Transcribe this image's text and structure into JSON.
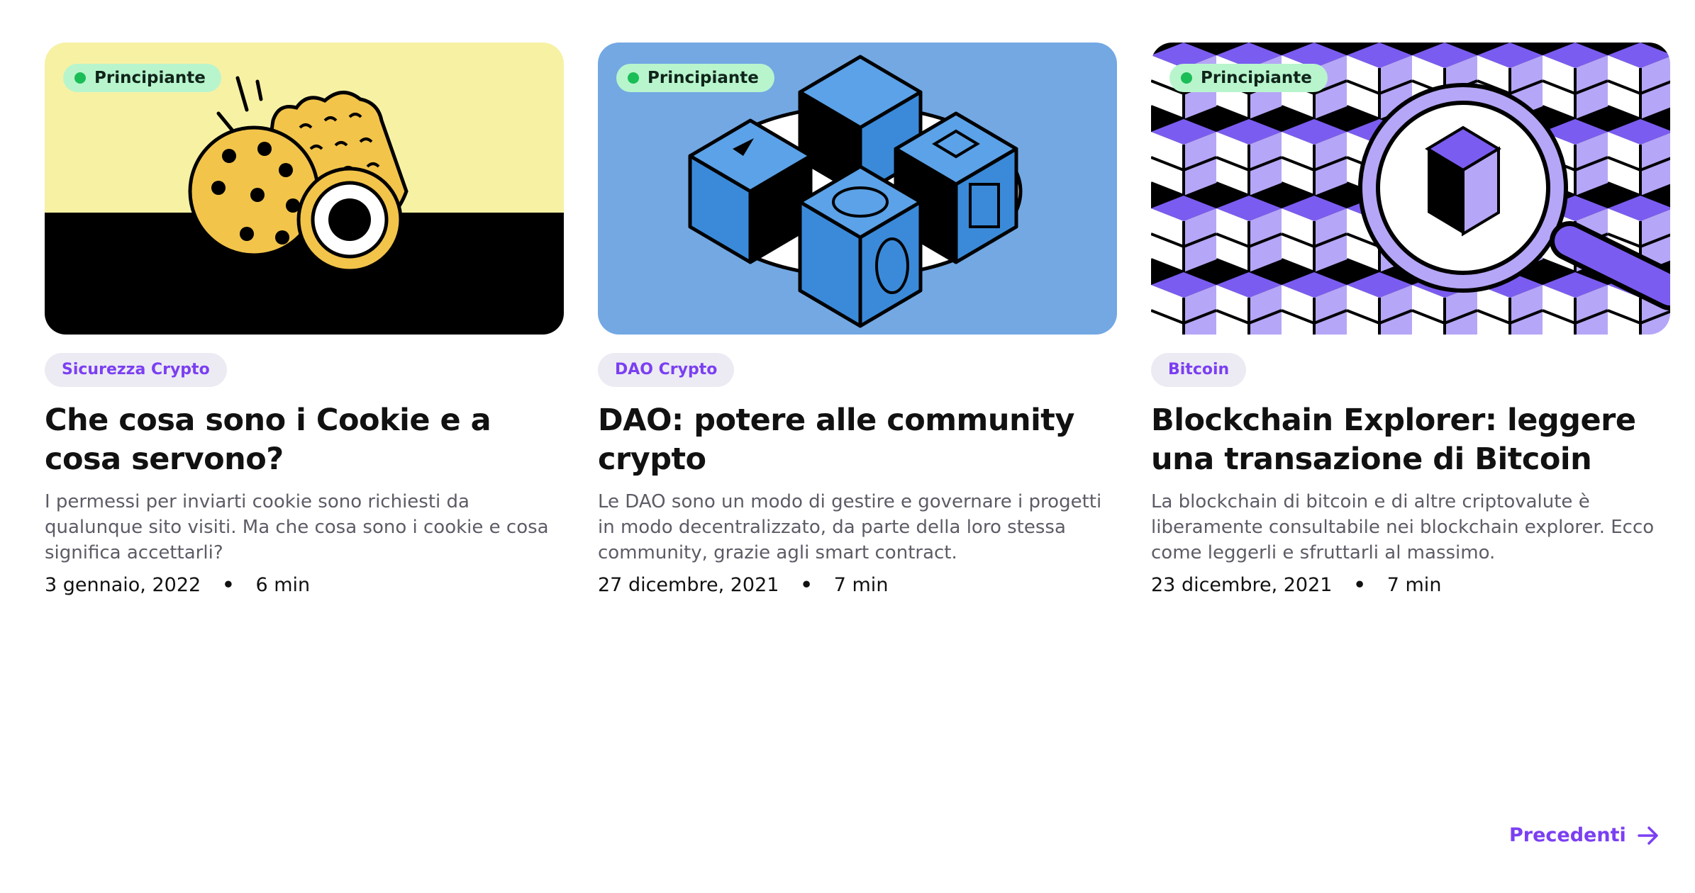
{
  "articles": [
    {
      "level": "Principiante",
      "category": "Sicurezza Crypto",
      "title": "Che cosa sono i Cookie e a cosa servono?",
      "description": "I permessi per inviarti cookie sono richiesti da qualunque sito visiti. Ma che cosa sono i cookie e cosa significa accettarli?",
      "date": "3 gennaio, 2022",
      "read_time": "6 min",
      "thumb_colors": {
        "top": "#f7f1a4",
        "bottom": "#000000"
      }
    },
    {
      "level": "Principiante",
      "category": "DAO Crypto",
      "title": "DAO: potere alle community crypto",
      "description": "Le DAO sono un modo di gestire e governare i progetti in modo decentralizzato, da parte della loro stessa community, grazie agli smart contract.",
      "date": "27 dicembre, 2021",
      "read_time": "7 min",
      "thumb_colors": {
        "background": "#73a8e3",
        "cube": "#3a8ad9"
      }
    },
    {
      "level": "Principiante",
      "category": "Bitcoin",
      "title": "Blockchain Explorer: leggere una transazione di Bitcoin",
      "description": "La blockchain di bitcoin e di altre criptovalute è liberamente consultabile nei blockchain explorer. Ecco come leggerli e sfruttarli al massimo.",
      "date": "23 dicembre, 2021",
      "read_time": "7 min",
      "thumb_colors": {
        "purple": "#7b5cf0",
        "lavender": "#b6a6f7"
      }
    }
  ],
  "pagination": {
    "label": "Precedenti"
  },
  "separator": "•",
  "colors": {
    "accent": "#7b3ff2",
    "badge_bg": "#b8f5cd",
    "badge_dot": "#1bbd57",
    "tag_bg": "#ecebf3"
  },
  "icons": {
    "next": "arrow-right-icon"
  }
}
